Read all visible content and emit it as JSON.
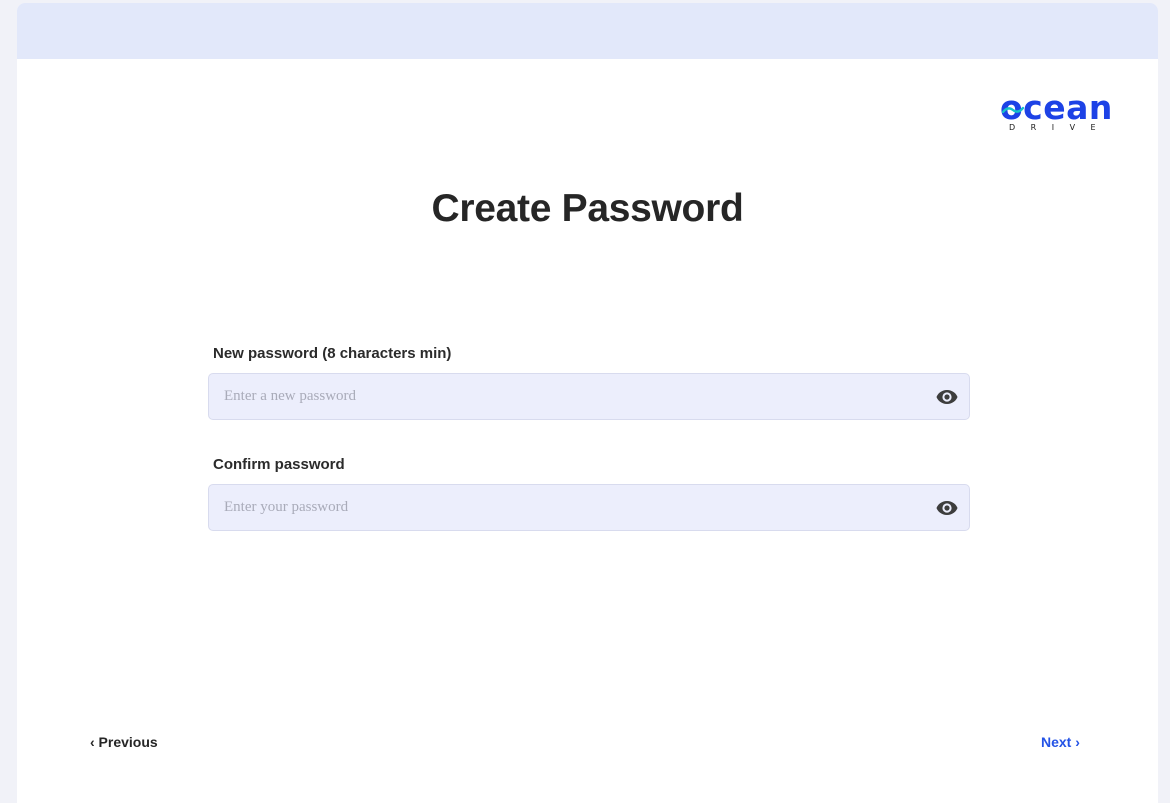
{
  "brand": {
    "word": "ocean",
    "sub": "DRIVE",
    "color": "#1d42e6"
  },
  "page": {
    "title": "Create Password"
  },
  "form": {
    "new_password": {
      "label": "New password (8 characters min)",
      "placeholder": "Enter a new password",
      "value": "",
      "icon": "eye-icon"
    },
    "confirm_password": {
      "label": "Confirm password",
      "placeholder": "Enter your password",
      "value": "",
      "icon": "eye-icon"
    }
  },
  "nav": {
    "previous_label": "‹ Previous",
    "next_label": "Next ›",
    "next_color": "#2453e6"
  },
  "colors": {
    "header_band": "#e2e8fa",
    "input_bg": "#eceefc",
    "page_bg": "#f1f2f8"
  }
}
